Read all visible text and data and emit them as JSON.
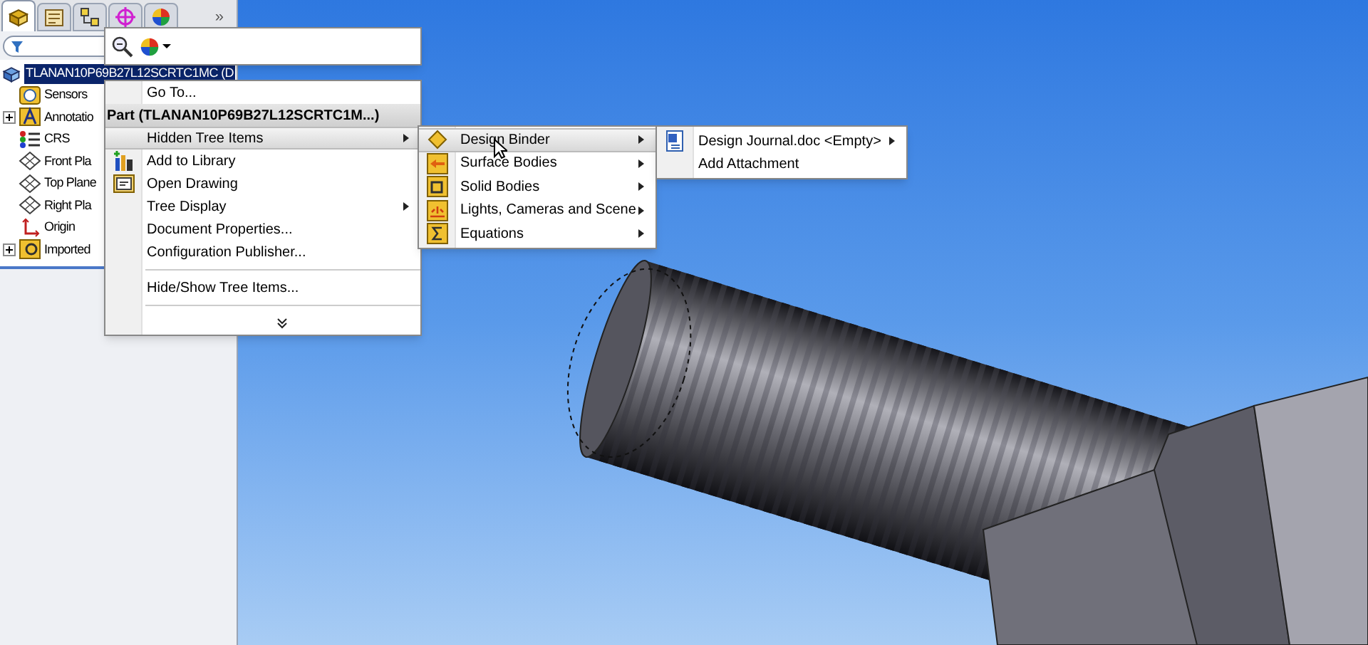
{
  "panel_tabs": [
    {
      "kind": "features",
      "selected": true
    },
    {
      "kind": "properties",
      "selected": false
    },
    {
      "kind": "configurations",
      "selected": false
    },
    {
      "kind": "dimxpert",
      "selected": false
    },
    {
      "kind": "display",
      "selected": false
    }
  ],
  "more_tabs": "»",
  "tree": {
    "root": "TLANAN10P69B27L12SCRTC1MC (D",
    "items": [
      {
        "label": "Sensors",
        "kind": "sensors"
      },
      {
        "label": "Annotatio",
        "kind": "annotations",
        "expanded": false
      },
      {
        "label": "CRS",
        "kind": "csys"
      },
      {
        "label": "Front Pla",
        "kind": "plane"
      },
      {
        "label": "Top Plane",
        "kind": "plane"
      },
      {
        "label": "Right Pla",
        "kind": "plane"
      },
      {
        "label": "Origin",
        "kind": "origin"
      },
      {
        "label": "Imported",
        "kind": "imported",
        "expanded": false
      }
    ]
  },
  "context_menu": {
    "header": "Part (TLANAN10P69B27L12SCRTC1M...)",
    "sections": [
      [
        {
          "label": "Go To...",
          "kind": "plain",
          "selected": false,
          "has_submenu": false
        },
        {
          "label": "Hidden Tree Items",
          "kind": "plain",
          "selected": true,
          "has_submenu": true
        },
        {
          "label": "Add to Library",
          "kind": "library",
          "selected": false,
          "has_submenu": false
        },
        {
          "label": "Open Drawing",
          "kind": "drawing",
          "selected": false,
          "has_submenu": false
        },
        {
          "label": "Tree Display",
          "kind": "plain",
          "selected": false,
          "has_submenu": true
        },
        {
          "label": "Document Properties...",
          "kind": "plain",
          "selected": false,
          "has_submenu": false
        },
        {
          "label": "Configuration Publisher...",
          "kind": "plain",
          "selected": false,
          "has_submenu": false
        }
      ],
      [
        {
          "label": "Hide/Show Tree Items...",
          "kind": "plain",
          "selected": false,
          "has_submenu": false
        }
      ]
    ]
  },
  "hidden_items_menu": [
    {
      "label": "Design Binder",
      "kind": "binder",
      "selected": true,
      "has_submenu": true
    },
    {
      "label": "Surface Bodies",
      "kind": "surface",
      "selected": false,
      "has_submenu": true
    },
    {
      "label": "Solid Bodies",
      "kind": "solid",
      "selected": false,
      "has_submenu": true
    },
    {
      "label": "Lights, Cameras and Scene",
      "kind": "lights",
      "selected": false,
      "has_submenu": true
    },
    {
      "label": "Equations",
      "kind": "equations",
      "selected": false,
      "has_submenu": true
    }
  ],
  "design_binder_menu": [
    {
      "label": "Design Journal.doc <Empty>",
      "kind": "document",
      "has_submenu": true
    },
    {
      "label": "Add Attachment",
      "kind": "plain",
      "has_submenu": false
    }
  ]
}
